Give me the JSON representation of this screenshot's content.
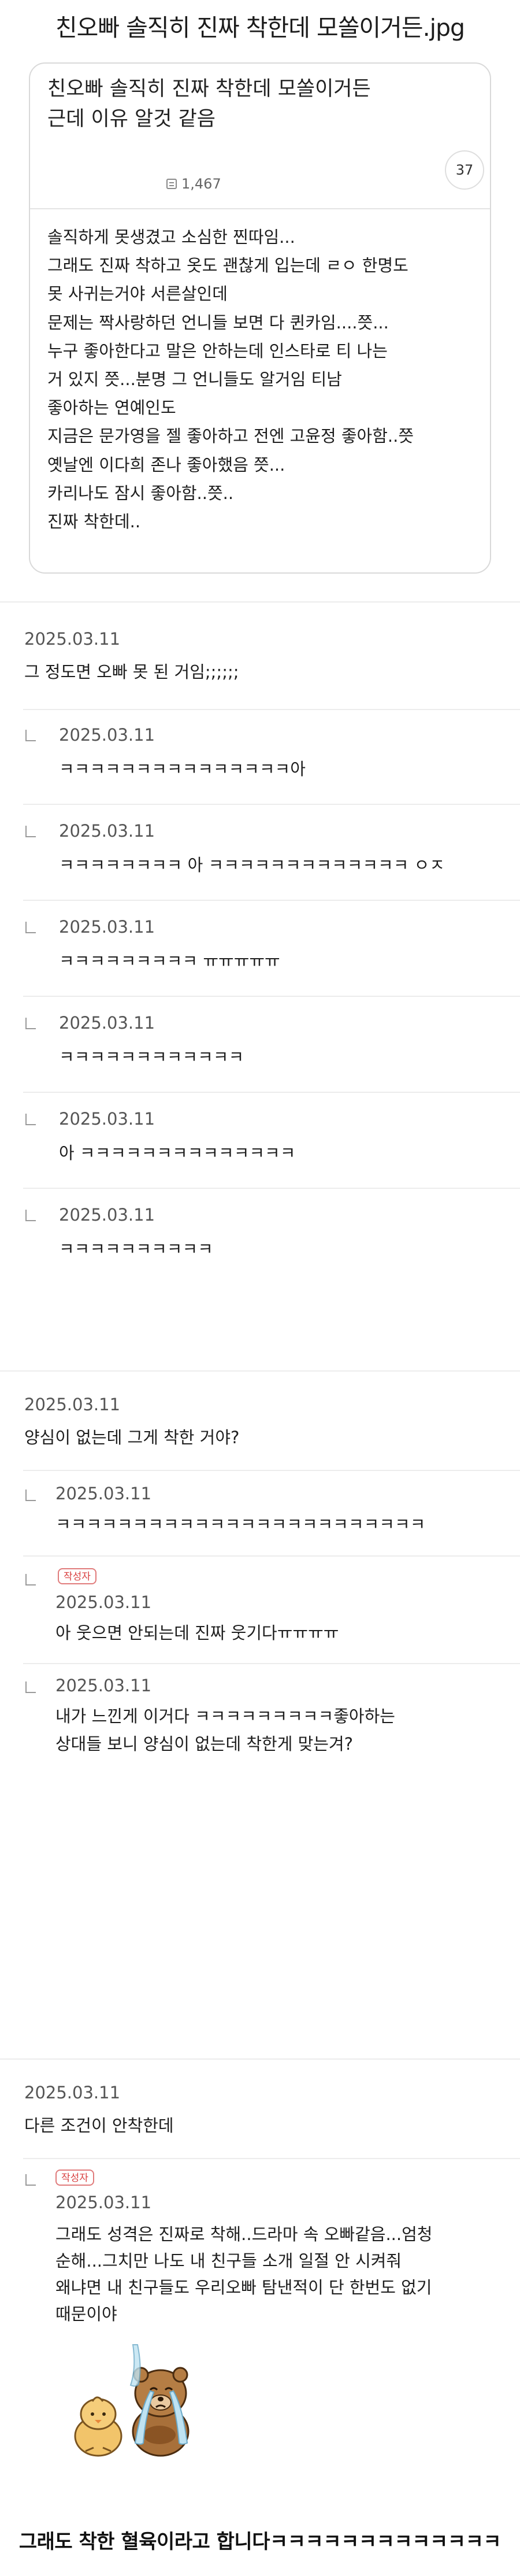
{
  "page": {
    "title": "친오빠 솔직히 진짜 착한데 모쏠이거든.jpg"
  },
  "post": {
    "title_lines": [
      "친오빠 솔직히 진짜 착한데 모쏠이거든",
      "근데 이유 알것 같음"
    ],
    "views": "1,467",
    "comment_count": "37",
    "body_lines": [
      "솔직하게 못생겼고 소심한 찐따임...",
      "그래도 진짜 착하고 옷도 괜찮게 입는데 ㄹㅇ 한명도",
      "못 사귀는거야 서른살인데",
      "문제는 짝사랑하던 언니들 보면 다 퀸카임....쯧...",
      "누구 좋아한다고 말은 안하는데 인스타로 티 나는",
      "거 있지 쯧...분명 그 언니들도 알거임 티남",
      "좋아하는 연예인도",
      "지금은 문가영을 젤 좋아하고 전엔 고윤정 좋아함..쯧",
      "옛날엔 이다희 존나 좋아했음 쯧...",
      "카리나도 잠시 좋아함..쯧..",
      "진짜 착한데.."
    ]
  },
  "threads": [
    {
      "date": "2025.03.11",
      "text": "그 정도면 오빠 못 된 거임;;;;;;",
      "replies": [
        {
          "date": "2025.03.11",
          "text": "ㅋㅋㅋㅋㅋㅋㅋㅋㅋㅋㅋㅋㅋㅋㅋ아"
        },
        {
          "date": "2025.03.11",
          "text": "ㅋㅋㅋㅋㅋㅋㅋㅋ 아 ㅋㅋㅋㅋㅋㅋㅋㅋㅋㅋㅋㅋㅋ ㅇㅈ"
        },
        {
          "date": "2025.03.11",
          "text": "ㅋㅋㅋㅋㅋㅋㅋㅋㅋ ㅠㅠㅠㅠㅠ"
        },
        {
          "date": "2025.03.11",
          "text": "ㅋㅋㅋㅋㅋㅋㅋㅋㅋㅋㅋㅋ"
        },
        {
          "date": "2025.03.11",
          "text": "아 ㅋㅋㅋㅋㅋㅋㅋㅋㅋㅋㅋㅋㅋㅋ"
        },
        {
          "date": "2025.03.11",
          "text": "ㅋㅋㅋㅋㅋㅋㅋㅋㅋㅋ"
        }
      ]
    },
    {
      "date": "2025.03.11",
      "text": "양심이 없는데 그게 착한 거야?",
      "replies": [
        {
          "date": "2025.03.11",
          "text": "ㅋㅋㅋㅋㅋㅋㅋㅋㅋㅋㅋㅋㅋㅋㅋㅋㅋㅋㅋㅋㅋㅋㅋㅋ"
        },
        {
          "badge": "작성자",
          "date": "2025.03.11",
          "text": "아 웃으면 안되는데 진짜 웃기다ㅠㅠㅠㅠ"
        },
        {
          "date": "2025.03.11",
          "lines": [
            "내가 느낀게 이거다 ㅋㅋㅋㅋㅋㅋㅋㅋㅋ좋아하는",
            "상대들 보니 양심이 없는데 착한게 맞는겨?"
          ]
        }
      ]
    },
    {
      "date": "2025.03.11",
      "text": "다른 조건이 안착한데",
      "replies": [
        {
          "badge": "작성자",
          "date": "2025.03.11",
          "lines": [
            "그래도 성격은 진짜로 착해..드라마 속 오빠같음...엄청",
            "순해...그치만 나도 내 친구들 소개 일절 안 시켜줘",
            "왜냐면 내 친구들도 우리오빠 탐낸적이 단 한번도 없기",
            "때문이야"
          ]
        }
      ]
    }
  ],
  "emoticon": "crying-bear-and-chick-emoticon",
  "caption": "그래도 착한 혈육이라고 합니다ㅋㅋㅋㅋㅋㅋㅋㅋㅋㅋㅋㅋㅋ",
  "colors": {
    "badge_red": "#d94040",
    "divider": "#ececec",
    "card_border": "#d9d9d9"
  }
}
